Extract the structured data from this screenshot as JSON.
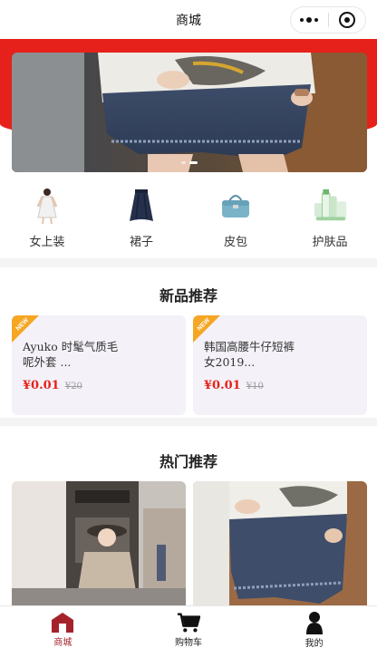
{
  "navbar": {
    "title": "商城"
  },
  "banner": {
    "slides": 2,
    "active_slide": 2
  },
  "categories": [
    {
      "label": "女上装",
      "icon": "dress-icon"
    },
    {
      "label": "裙子",
      "icon": "skirt-icon"
    },
    {
      "label": "皮包",
      "icon": "handbag-icon"
    },
    {
      "label": "护肤品",
      "icon": "skincare-icon"
    }
  ],
  "new_section": {
    "title": "新品推荐",
    "badge": "NEW",
    "items": [
      {
        "name": "Ayuko 时髦气质毛呢外套 ...",
        "price": "¥0.01",
        "old_price": "¥20"
      },
      {
        "name": "韩国高腰牛仔短裤女2019...",
        "price": "¥0.01",
        "old_price": "¥10"
      }
    ]
  },
  "hot_section": {
    "title": "热门推荐"
  },
  "tabbar": [
    {
      "label": "商城",
      "icon": "store-icon",
      "active": true
    },
    {
      "label": "购物车",
      "icon": "cart-icon",
      "active": false
    },
    {
      "label": "我的",
      "icon": "user-icon",
      "active": false
    }
  ],
  "colors": {
    "accent": "#e6211b",
    "tab_active": "#a5222a",
    "card_bg": "#f4f2f8",
    "badge": "#f5a623"
  }
}
